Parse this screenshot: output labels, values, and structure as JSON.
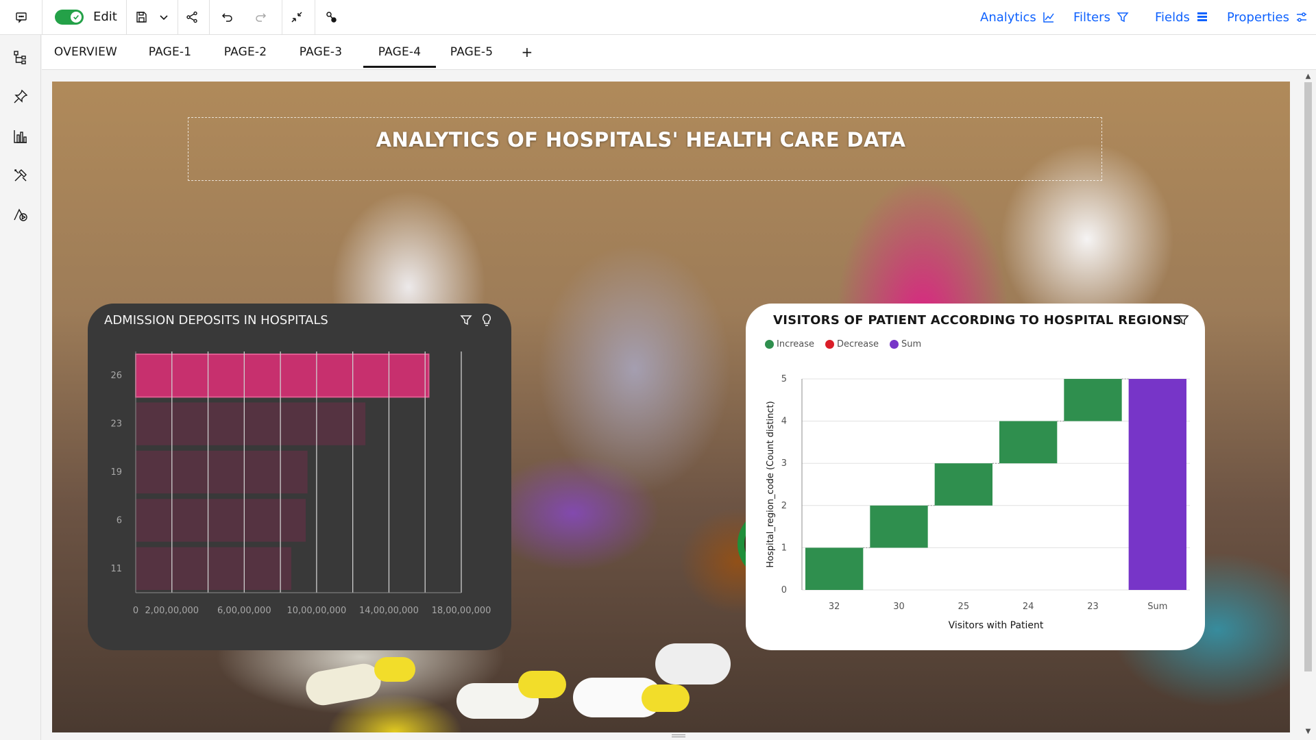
{
  "toolbar": {
    "edit_label": "Edit",
    "edit_mode_on": true,
    "icons": [
      "comment-icon",
      "save-icon",
      "chevron-down-icon",
      "share-icon",
      "undo-icon",
      "redo-icon",
      "collapse-icon",
      "pin-connect-icon"
    ],
    "menu": [
      {
        "label": "Analytics",
        "icon": "analytics-icon"
      },
      {
        "label": "Filters",
        "icon": "filter-icon"
      },
      {
        "label": "Fields",
        "icon": "fields-icon"
      },
      {
        "label": "Properties",
        "icon": "properties-icon"
      }
    ],
    "accent_color": "#0f62fe",
    "toggle_color": "#24a148"
  },
  "sidebar": {
    "icons": [
      "data-tree-icon",
      "pin-icon",
      "chart-icon",
      "tools-icon",
      "shapes-icon"
    ]
  },
  "tabs": {
    "items": [
      "OVERVIEW",
      "PAGE-1",
      "PAGE-2",
      "PAGE-3",
      "PAGE-4",
      "PAGE-5"
    ],
    "active": "PAGE-4",
    "add_label": "+"
  },
  "canvas": {
    "title": "ANALYTICS OF HOSPITALS' HEALTH CARE DATA"
  },
  "chart_data": [
    {
      "type": "bar",
      "orientation": "horizontal",
      "title": "ADMISSION DEPOSITS IN HOSPITALS",
      "categories": [
        "26",
        "23",
        "19",
        "6",
        "11"
      ],
      "values": [
        1620000000,
        1270000000,
        950000000,
        940000000,
        860000000
      ],
      "highlighted_category": "26",
      "xlim": [
        0,
        1800000000
      ],
      "xticks": [
        0,
        200000000,
        600000000,
        1000000000,
        1400000000,
        1800000000
      ],
      "xtick_labels": [
        "0",
        "2,00,00,000",
        "6,00,00,000",
        "10,00,00,000",
        "14,00,00,000",
        "18,00,00,000"
      ],
      "colors": {
        "highlight": "#c7306e",
        "bar": "#553341",
        "grid": "#cfcfcf",
        "background": "#393939"
      }
    },
    {
      "type": "bar",
      "subtype": "waterfall",
      "title": "VISITORS OF PATIENT ACCORDING TO HOSPITAL REGIONS",
      "legend": [
        {
          "name": "Increase",
          "color": "#2f8f4e"
        },
        {
          "name": "Decrease",
          "color": "#da1e28"
        },
        {
          "name": "Sum",
          "color": "#7735c8"
        }
      ],
      "categories": [
        "32",
        "30",
        "25",
        "24",
        "23",
        "Sum"
      ],
      "deltas": [
        1,
        1,
        1,
        1,
        1
      ],
      "sum": 5,
      "xlabel": "Visitors with Patient",
      "ylabel": "Hospital_region_code (Count distinct)",
      "ylim": [
        0,
        5
      ],
      "yticks": [
        0,
        1,
        2,
        3,
        4,
        5
      ]
    }
  ]
}
